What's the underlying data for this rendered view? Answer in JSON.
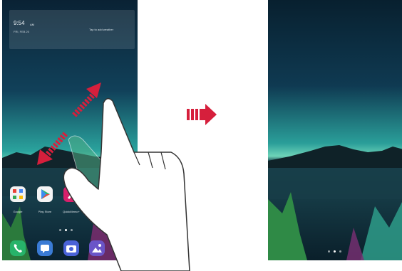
{
  "left_screen": {
    "widget": {
      "time": "9:54",
      "time_suffix": "AM",
      "date": "FRI, FEB 20",
      "weather_text": "Tap to add weather"
    },
    "apps": [
      {
        "label": "Google",
        "icon": "google-folder-icon"
      },
      {
        "label": "Play Store",
        "icon": "play-store-icon"
      },
      {
        "label": "QuickMemo+",
        "icon": "quickmemo-icon"
      }
    ],
    "dock": [
      {
        "icon": "phone-icon",
        "color": "#27b36a"
      },
      {
        "icon": "messages-icon",
        "color": "#3a7bd5"
      },
      {
        "icon": "camera-icon",
        "color": "#4a63d8"
      },
      {
        "icon": "gallery-icon",
        "color": "#6a55c8"
      }
    ]
  },
  "transition_arrow": {
    "icon": "forward-arrow-icon",
    "color": "#d61f3c"
  },
  "gesture": {
    "icon": "pinch-out-hand-icon",
    "arrow_color": "#d61f3c"
  },
  "colors": {
    "sky_top": "#0b2638",
    "sky_horizon": "#2ba6a0",
    "accent_red": "#d61f3c"
  }
}
